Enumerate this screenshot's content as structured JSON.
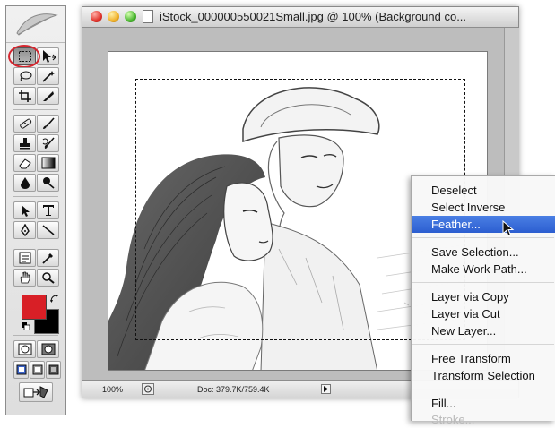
{
  "document": {
    "title": "iStock_000000550021Small.jpg @ 100% (Background co...",
    "zoom": "100%",
    "doc_info": "Doc: 379.7K/759.4K"
  },
  "toolbox": {
    "foreground_color": "#d81f26",
    "background_color": "#000000",
    "tools": [
      "rectangular-marquee",
      "move",
      "lasso",
      "magic-wand",
      "crop",
      "slice",
      "healing-brush",
      "brush",
      "clone-stamp",
      "history-brush",
      "eraser",
      "gradient",
      "blur",
      "dodge",
      "path-selection",
      "type",
      "pen",
      "line",
      "notes",
      "eyedropper",
      "hand",
      "zoom",
      "default-colors",
      "swap-colors",
      "standard-mode",
      "quick-mask",
      "screen-mode-standard",
      "screen-mode-full-menu",
      "screen-mode-full",
      "jump-to-imageready"
    ]
  },
  "context_menu": {
    "items": [
      {
        "label": "Deselect"
      },
      {
        "label": "Select Inverse"
      },
      {
        "label": "Feather..."
      },
      {
        "label": "Save Selection..."
      },
      {
        "label": "Make Work Path..."
      },
      {
        "label": "Layer via Copy"
      },
      {
        "label": "Layer via Cut"
      },
      {
        "label": "New Layer..."
      },
      {
        "label": "Free Transform"
      },
      {
        "label": "Transform Selection"
      },
      {
        "label": "Fill..."
      },
      {
        "label": "Stroke..."
      }
    ],
    "selected": "Feather...",
    "highlight_color": "#3265d6"
  }
}
